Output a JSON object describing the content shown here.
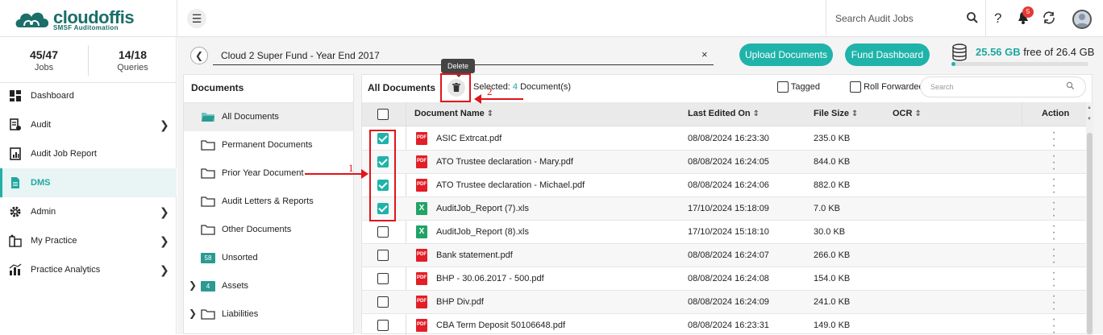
{
  "brand": {
    "name": "cloudoffis",
    "tagline": "SMSF Auditomation"
  },
  "header": {
    "search_placeholder": "Search Audit Jobs",
    "notification_count": "5",
    "help_label": "?"
  },
  "sidebar": {
    "stats": [
      {
        "value": "45/47",
        "label": "Jobs"
      },
      {
        "value": "14/18",
        "label": "Queries"
      }
    ],
    "items": [
      {
        "label": "Dashboard",
        "icon": "dashboard-icon",
        "has_children": false,
        "active": false
      },
      {
        "label": "Audit",
        "icon": "audit-icon",
        "has_children": true,
        "active": false
      },
      {
        "label": "Audit Job Report",
        "icon": "report-icon",
        "has_children": false,
        "active": false
      },
      {
        "label": "DMS",
        "icon": "document-icon",
        "has_children": false,
        "active": true
      },
      {
        "label": "Admin",
        "icon": "gear-icon",
        "has_children": true,
        "active": false
      },
      {
        "label": "My Practice",
        "icon": "practice-icon",
        "has_children": true,
        "active": false
      },
      {
        "label": "Practice Analytics",
        "icon": "analytics-icon",
        "has_children": true,
        "active": false
      }
    ]
  },
  "job": {
    "title": "Cloud 2 Super Fund - Year End 2017",
    "clear_label": "×"
  },
  "actions": {
    "upload": "Upload Documents",
    "fund_dashboard": "Fund Dashboard"
  },
  "storage": {
    "used": "25.56 GB",
    "rest": " free of 26.4 GB",
    "fill_fraction": 0.03
  },
  "documents_panel": {
    "title": "Documents",
    "folders": [
      {
        "label": "All Documents",
        "selected": true,
        "expandable": false,
        "badge": ""
      },
      {
        "label": "Permanent Documents",
        "selected": false,
        "expandable": false,
        "badge": ""
      },
      {
        "label": "Prior Year Document",
        "selected": false,
        "expandable": false,
        "badge": ""
      },
      {
        "label": "Audit Letters & Reports",
        "selected": false,
        "expandable": false,
        "badge": ""
      },
      {
        "label": "Other Documents",
        "selected": false,
        "expandable": false,
        "badge": ""
      },
      {
        "label": "Unsorted",
        "selected": false,
        "expandable": false,
        "badge": "58"
      },
      {
        "label": "Assets",
        "selected": false,
        "expandable": true,
        "badge": "4"
      },
      {
        "label": "Liabilities",
        "selected": false,
        "expandable": true,
        "badge": ""
      }
    ]
  },
  "main": {
    "title": "All Documents",
    "delete_tooltip": "Delete",
    "selected_prefix": "Selected: ",
    "selected_count": "4",
    "selected_suffix": " Document(s)",
    "tagged_label": "Tagged",
    "rolled_label": "Roll Forwarded",
    "search_placeholder": "Search",
    "columns": {
      "name": "Document Name",
      "edited": "Last Edited On",
      "size": "File Size",
      "ocr": "OCR",
      "action": "Action"
    },
    "rows": [
      {
        "name": "ASIC Extrcat.pdf",
        "edited": "08/08/2024 16:23:30",
        "size": "235.0 KB",
        "type": "pdf",
        "checked": true
      },
      {
        "name": "ATO Trustee declaration - Mary.pdf",
        "edited": "08/08/2024 16:24:05",
        "size": "844.0 KB",
        "type": "pdf",
        "checked": true
      },
      {
        "name": "ATO Trustee declaration - Michael.pdf",
        "edited": "08/08/2024 16:24:06",
        "size": "882.0 KB",
        "type": "pdf",
        "checked": true
      },
      {
        "name": "AuditJob_Report (7).xls",
        "edited": "17/10/2024 15:18:09",
        "size": "7.0 KB",
        "type": "xls",
        "checked": true
      },
      {
        "name": "AuditJob_Report (8).xls",
        "edited": "17/10/2024 15:18:10",
        "size": "30.0 KB",
        "type": "xls",
        "checked": false
      },
      {
        "name": "Bank statement.pdf",
        "edited": "08/08/2024 16:24:07",
        "size": "266.0 KB",
        "type": "pdf",
        "checked": false
      },
      {
        "name": "BHP - 30.06.2017 - 500.pdf",
        "edited": "08/08/2024 16:24:08",
        "size": "154.0 KB",
        "type": "pdf",
        "checked": false
      },
      {
        "name": "BHP Div.pdf",
        "edited": "08/08/2024 16:24:09",
        "size": "241.0 KB",
        "type": "pdf",
        "checked": false
      },
      {
        "name": "CBA Term Deposit 50106648.pdf",
        "edited": "08/08/2024 16:23:31",
        "size": "149.0 KB",
        "type": "pdf",
        "checked": false
      }
    ]
  },
  "annotations": {
    "step1": "1",
    "step2": "2",
    "color": "#e0141b"
  },
  "colors": {
    "accent": "#1fb3aa",
    "pdf": "#e21e26",
    "xls": "#21a366",
    "brand": "#1b6e6a"
  }
}
